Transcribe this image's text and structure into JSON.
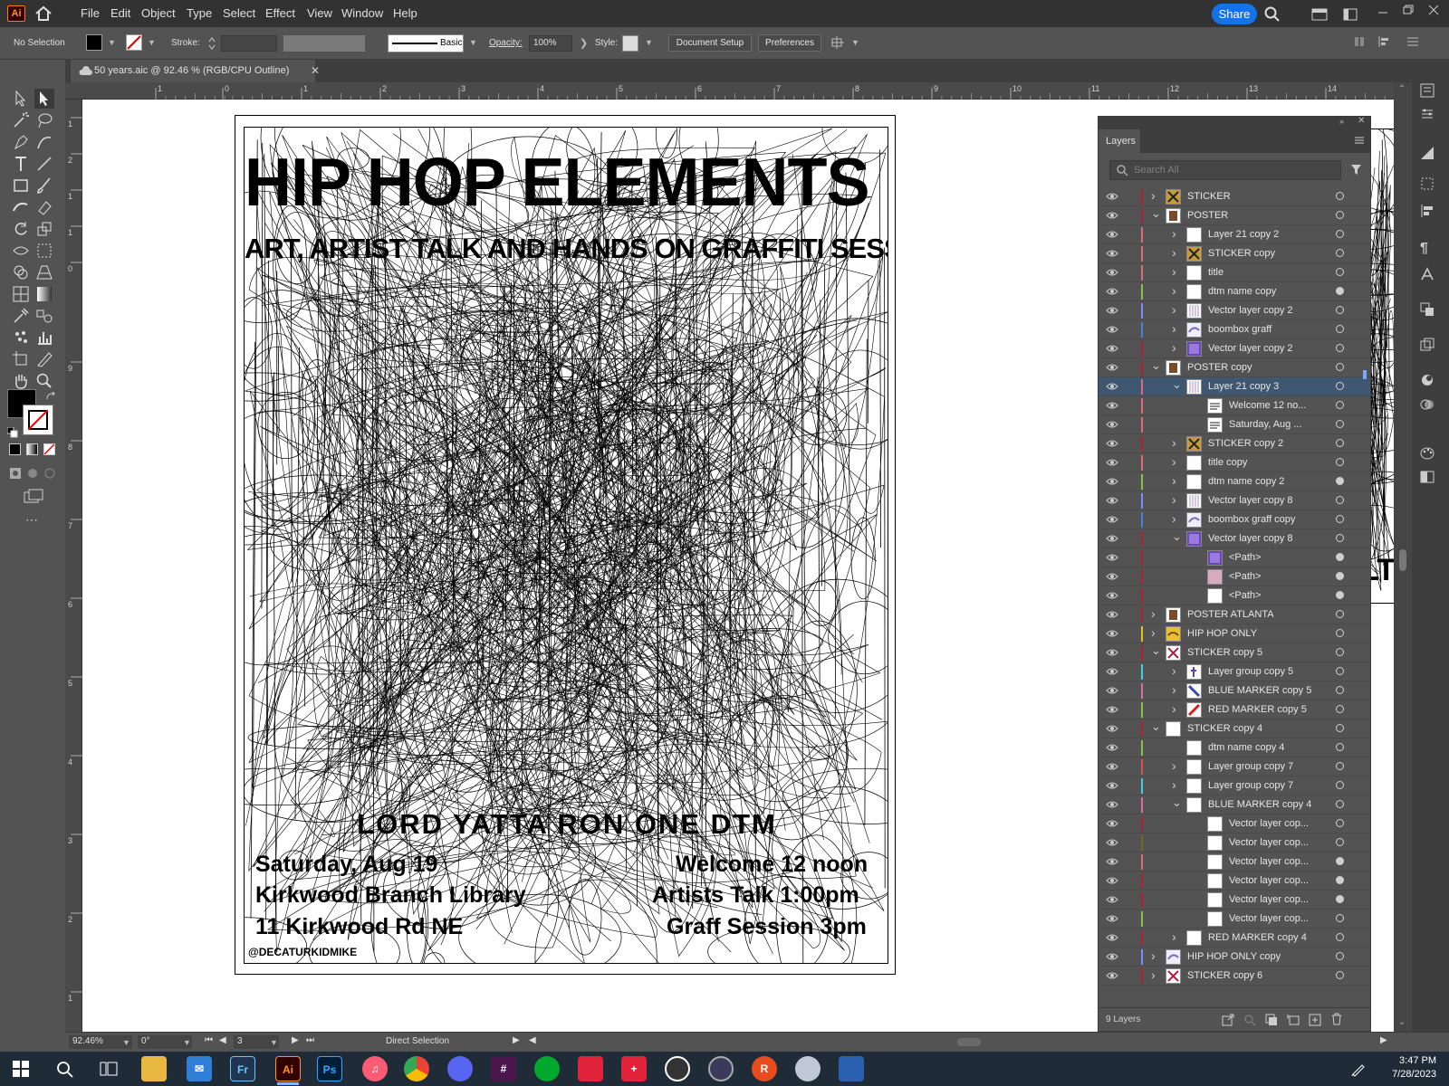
{
  "app": {
    "logo": "Ai"
  },
  "menu": [
    "File",
    "Edit",
    "Object",
    "Type",
    "Select",
    "Effect",
    "View",
    "Window",
    "Help"
  ],
  "share_label": "Share",
  "control": {
    "selection": "No Selection",
    "stroke_label": "Stroke:",
    "brush_label": "Basic",
    "opacity_label": "Opacity:",
    "opacity_value": "100%",
    "style_label": "Style:",
    "doc_setup": "Document Setup",
    "preferences": "Preferences"
  },
  "tab": {
    "title": "50 years.aic @ 92.46 % (RGB/CPU Outline)"
  },
  "rulers": {
    "h": [
      "1",
      "0",
      "1",
      "2",
      "3",
      "4",
      "5",
      "6",
      "7",
      "8",
      "9",
      "10",
      "11",
      "12",
      "13",
      "14"
    ],
    "v": [
      "1",
      "2",
      "1",
      "1",
      "0",
      "9",
      "8",
      "7",
      "6",
      "5",
      "4",
      "3",
      "2",
      "1"
    ]
  },
  "poster": {
    "title": "HIP HOP ELEMENTS ONE",
    "subtitle": "ART, ARTIST TALK AND HANDS ON GRAFFITI SESSION",
    "artists": "LORD YATTA   RON ONE   DTM",
    "date": "Saturday, Aug 19",
    "venue": "Kirkwood Branch Library",
    "address": "11 Kirkwood Rd NE",
    "welcome": "Welcome 12 noon",
    "talk": "Artists Talk 1:00pm",
    "graff": "Graff Session 3pm",
    "credit": "@DECATURKIDMIKE",
    "side_text": "LTA"
  },
  "layers": {
    "tab": "Layers",
    "search_placeholder": "Search All",
    "count": "9 Layers",
    "rows": [
      {
        "name": "STICKER",
        "indent": 0,
        "expand": "right",
        "color": "#b0203a",
        "thumb": "sticker",
        "circle": "empty"
      },
      {
        "name": "POSTER",
        "indent": 0,
        "expand": "down",
        "color": "#b0203a",
        "thumb": "poster",
        "circle": "empty"
      },
      {
        "name": "Layer 21 copy 2",
        "indent": 1,
        "expand": "right",
        "color": "#e06a7a",
        "thumb": "white",
        "circle": "empty"
      },
      {
        "name": "STICKER copy",
        "indent": 1,
        "expand": "right",
        "color": "#e06a7a",
        "thumb": "sticker",
        "circle": "empty"
      },
      {
        "name": "title",
        "indent": 1,
        "expand": "right",
        "color": "#e06a7a",
        "thumb": "white",
        "circle": "empty"
      },
      {
        "name": "dtm name copy",
        "indent": 1,
        "expand": "right",
        "color": "#8bc34a",
        "thumb": "white",
        "circle": "filled"
      },
      {
        "name": "Vector layer copy 2",
        "indent": 1,
        "expand": "right",
        "color": "#7a8cff",
        "thumb": "lines",
        "circle": "empty"
      },
      {
        "name": "boombox graff",
        "indent": 1,
        "expand": "right",
        "color": "#4a7de0",
        "thumb": "graff",
        "circle": "empty"
      },
      {
        "name": "Vector layer copy 2",
        "indent": 1,
        "expand": "right",
        "color": "#b0203a",
        "thumb": "purple",
        "circle": "empty"
      },
      {
        "name": "POSTER copy",
        "indent": 0,
        "expand": "down",
        "color": "#b0203a",
        "thumb": "poster",
        "circle": "empty"
      },
      {
        "name": "Layer 21 copy 3",
        "indent": 1,
        "expand": "down",
        "color": "#e06a7a",
        "thumb": "lines",
        "circle": "empty",
        "selected": true
      },
      {
        "name": "Welcome 12 no...",
        "indent": 2,
        "expand": "none",
        "color": "#e06a7a",
        "thumb": "text",
        "circle": "empty"
      },
      {
        "name": "Saturday, Aug ...",
        "indent": 2,
        "expand": "none",
        "color": "#e06a7a",
        "thumb": "text",
        "circle": "empty"
      },
      {
        "name": "STICKER copy 2",
        "indent": 1,
        "expand": "right",
        "color": "#b0203a",
        "thumb": "sticker",
        "circle": "empty"
      },
      {
        "name": "title copy",
        "indent": 1,
        "expand": "right",
        "color": "#e06a7a",
        "thumb": "white",
        "circle": "empty"
      },
      {
        "name": "dtm name copy 2",
        "indent": 1,
        "expand": "right",
        "color": "#8bc34a",
        "thumb": "white",
        "circle": "filled"
      },
      {
        "name": "Vector layer copy 8",
        "indent": 1,
        "expand": "right",
        "color": "#7a8cff",
        "thumb": "lines",
        "circle": "empty"
      },
      {
        "name": "boombox graff copy",
        "indent": 1,
        "expand": "right",
        "color": "#4a7de0",
        "thumb": "graff",
        "circle": "empty"
      },
      {
        "name": "Vector layer copy 8",
        "indent": 1,
        "expand": "down",
        "color": "#b0203a",
        "thumb": "purple",
        "circle": "empty"
      },
      {
        "name": "<Path>",
        "indent": 2,
        "expand": "none",
        "color": "#b0203a",
        "thumb": "purple",
        "circle": "filled"
      },
      {
        "name": "<Path>",
        "indent": 2,
        "expand": "none",
        "color": "#b0203a",
        "thumb": "pink",
        "circle": "filled"
      },
      {
        "name": "<Path>",
        "indent": 2,
        "expand": "none",
        "color": "#b0203a",
        "thumb": "white",
        "circle": "filled"
      },
      {
        "name": "POSTER ATLANTA",
        "indent": 0,
        "expand": "right",
        "color": "#b0203a",
        "thumb": "poster",
        "circle": "empty"
      },
      {
        "name": "HIP HOP ONLY",
        "indent": 0,
        "expand": "right",
        "color": "#e0c020",
        "thumb": "yellow",
        "circle": "empty"
      },
      {
        "name": "STICKER copy 5",
        "indent": 0,
        "expand": "down",
        "color": "#b0203a",
        "thumb": "xmark",
        "circle": "empty"
      },
      {
        "name": "Layer group copy 5",
        "indent": 1,
        "expand": "right",
        "color": "#40d0e0",
        "thumb": "figure",
        "circle": "empty"
      },
      {
        "name": "BLUE MARKER copy 5",
        "indent": 1,
        "expand": "right",
        "color": "#e06a9a",
        "thumb": "slash-blue",
        "circle": "empty"
      },
      {
        "name": "RED MARKER copy 5",
        "indent": 1,
        "expand": "right",
        "color": "#8bc34a",
        "thumb": "slash-red",
        "circle": "empty"
      },
      {
        "name": "STICKER copy 4",
        "indent": 0,
        "expand": "down",
        "color": "#b0203a",
        "thumb": "white",
        "circle": "empty"
      },
      {
        "name": "dtm name copy 4",
        "indent": 1,
        "expand": "none",
        "color": "#8bc34a",
        "thumb": "white",
        "circle": "empty"
      },
      {
        "name": "Layer group copy 7",
        "indent": 1,
        "expand": "right",
        "color": "#e05050",
        "thumb": "white",
        "circle": "empty"
      },
      {
        "name": "Layer group copy 7",
        "indent": 1,
        "expand": "right",
        "color": "#40d0e0",
        "thumb": "white",
        "circle": "empty"
      },
      {
        "name": "BLUE MARKER copy 4",
        "indent": 1,
        "expand": "down",
        "color": "#e06a9a",
        "thumb": "white",
        "circle": "empty"
      },
      {
        "name": "Vector layer cop...",
        "indent": 2,
        "expand": "none",
        "color": "#b0203a",
        "thumb": "white",
        "circle": "empty"
      },
      {
        "name": "Vector layer cop...",
        "indent": 2,
        "expand": "none",
        "color": "#6b6b20",
        "thumb": "white",
        "circle": "empty"
      },
      {
        "name": "Vector layer cop...",
        "indent": 2,
        "expand": "none",
        "color": "#e06a7a",
        "thumb": "white",
        "circle": "filled"
      },
      {
        "name": "Vector layer cop...",
        "indent": 2,
        "expand": "none",
        "color": "#b0203a",
        "thumb": "white",
        "circle": "filled"
      },
      {
        "name": "Vector layer cop...",
        "indent": 2,
        "expand": "none",
        "color": "#b0203a",
        "thumb": "white",
        "circle": "filled"
      },
      {
        "name": "Vector layer cop...",
        "indent": 2,
        "expand": "none",
        "color": "#8bc34a",
        "thumb": "white",
        "circle": "empty"
      },
      {
        "name": "RED MARKER copy 4",
        "indent": 1,
        "expand": "right",
        "color": "#b0203a",
        "thumb": "white",
        "circle": "empty"
      },
      {
        "name": "HIP HOP ONLY copy",
        "indent": 0,
        "expand": "right",
        "color": "#7a8cff",
        "thumb": "graff",
        "circle": "empty"
      },
      {
        "name": "STICKER copy 6",
        "indent": 0,
        "expand": "right",
        "color": "#b0203a",
        "thumb": "xmark",
        "circle": "empty"
      }
    ]
  },
  "status": {
    "zoom": "92.46%",
    "rotation": "0°",
    "artboard": "3",
    "tool": "Direct Selection"
  },
  "clock": {
    "time": "3:47 PM",
    "date": "7/28/2023"
  },
  "colors": {
    "accent": "#1473e6",
    "selected_row": "#3f5770",
    "panel_bg": "#535353",
    "menubar_bg": "#323232"
  }
}
